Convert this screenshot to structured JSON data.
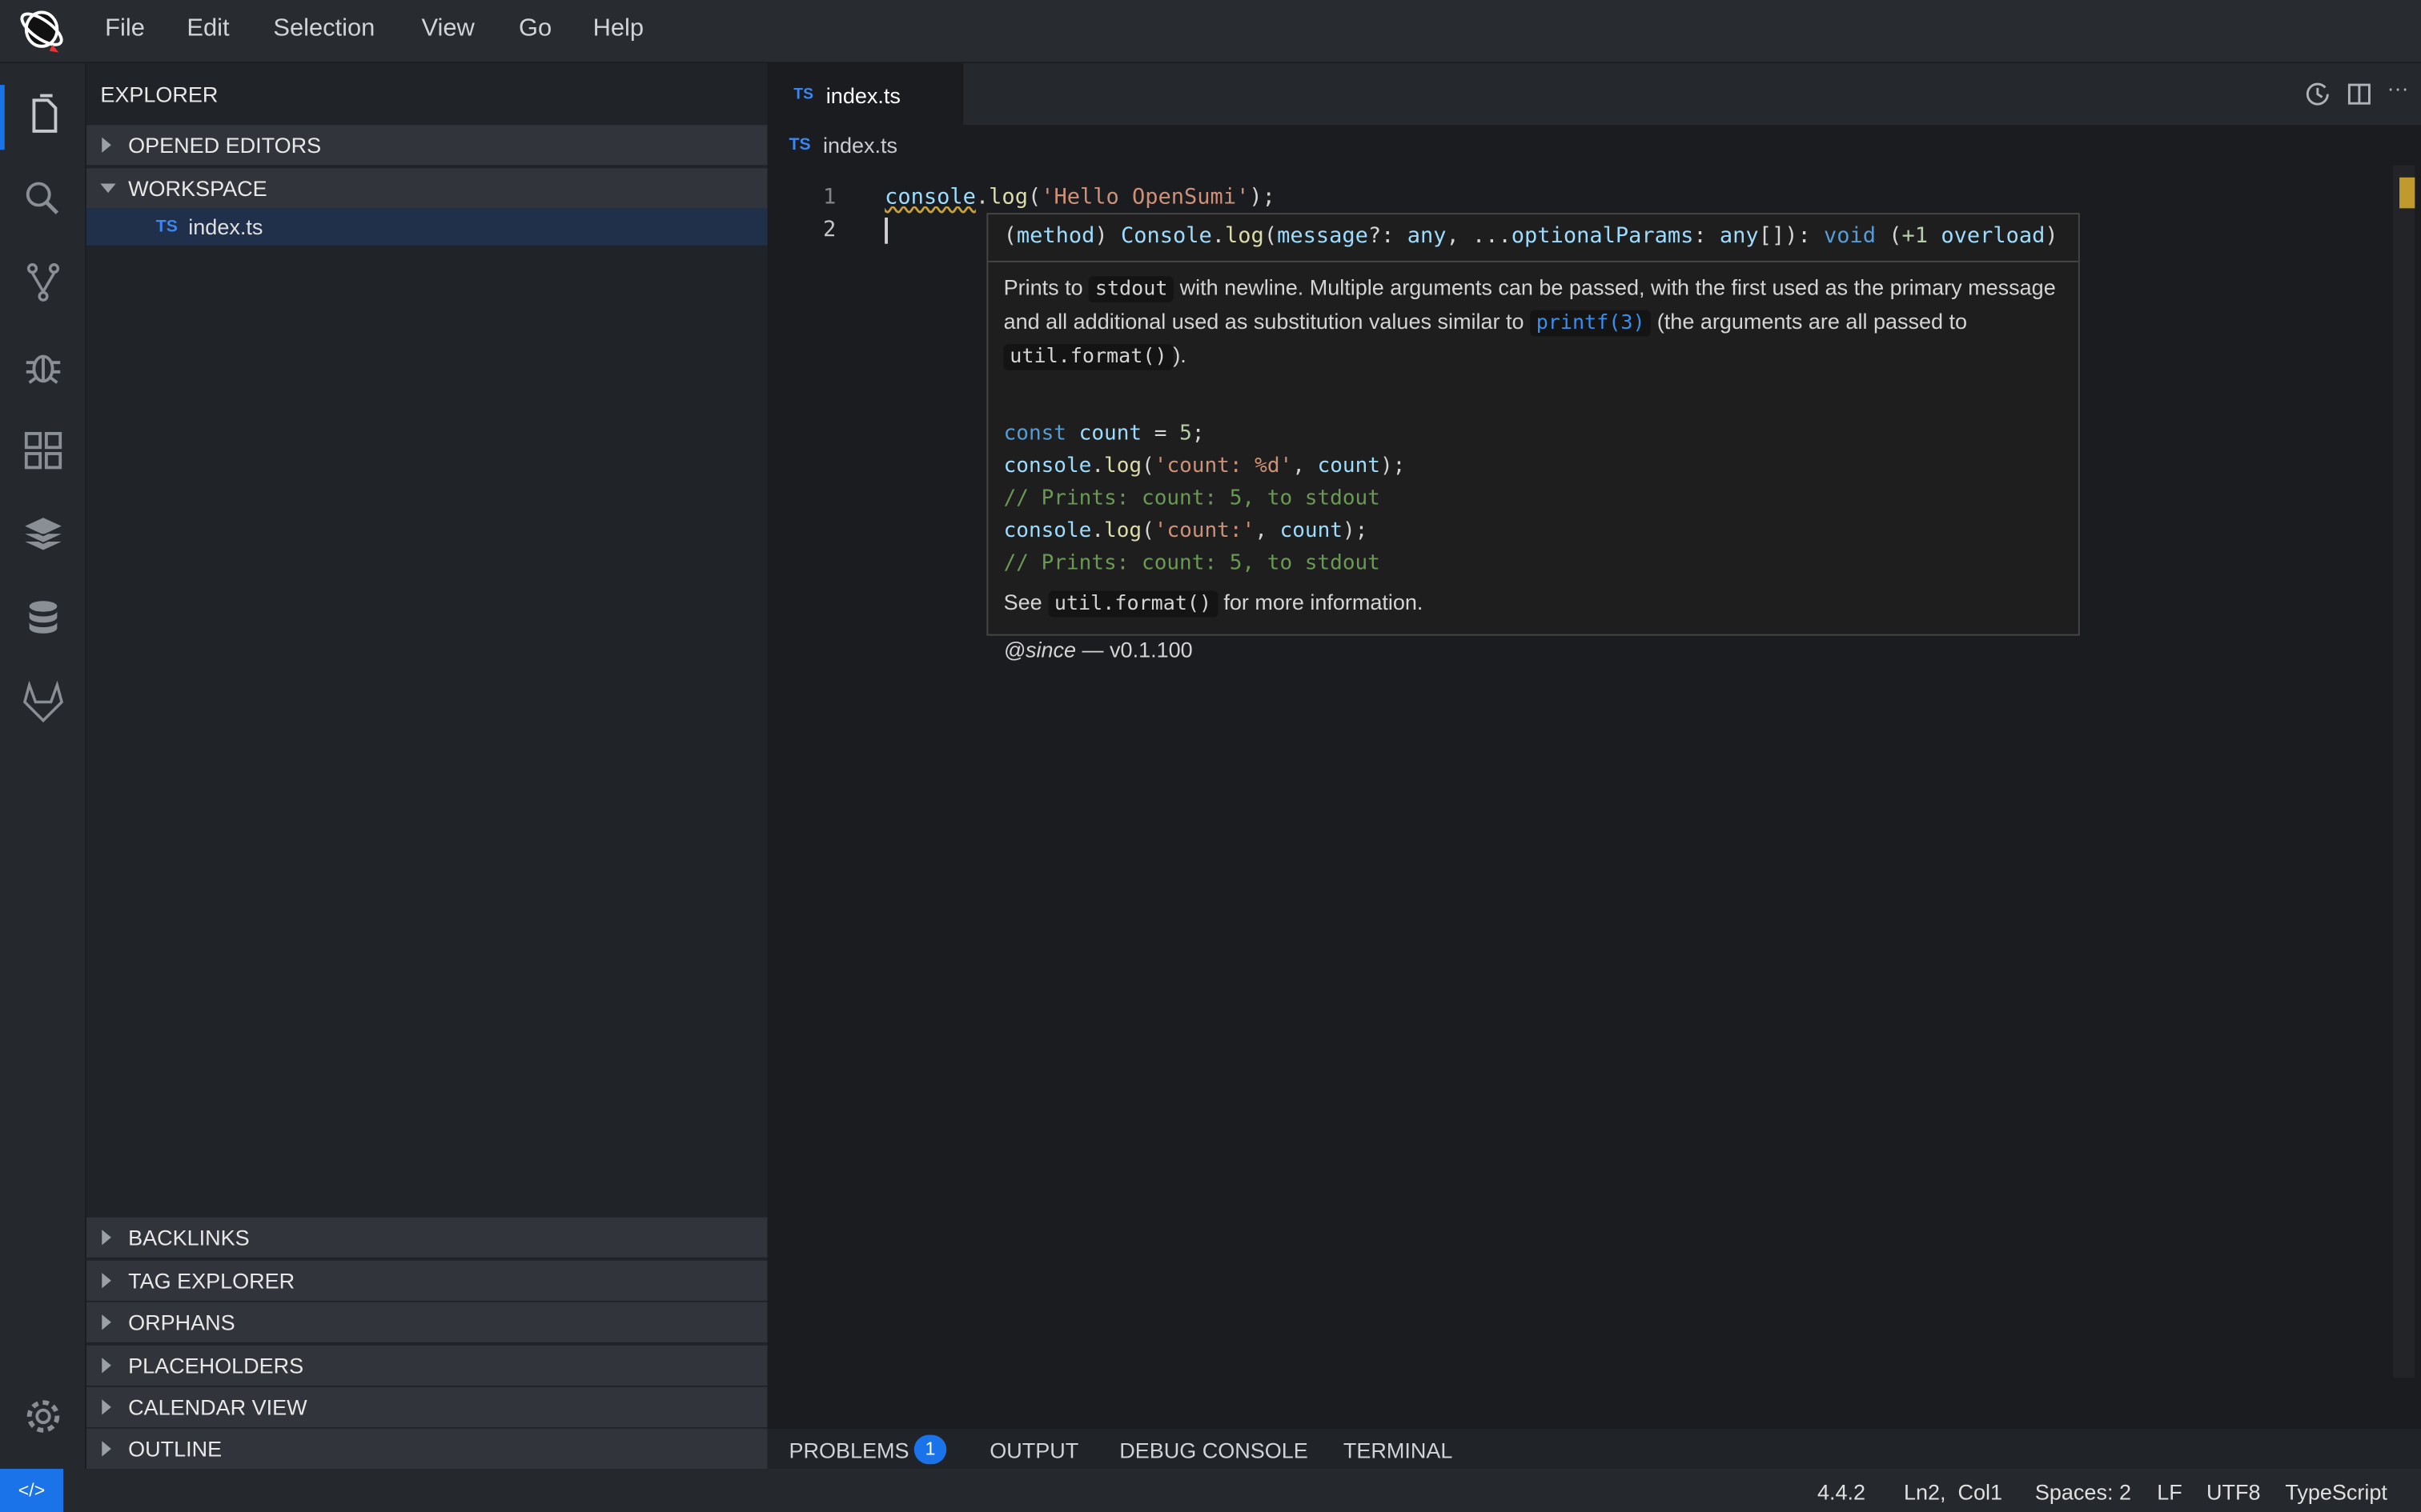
{
  "menubar": {
    "items": [
      "File",
      "Edit",
      "Selection",
      "View",
      "Go",
      "Help"
    ]
  },
  "activity": {
    "icons": [
      "files-icon",
      "search-icon",
      "source-control-icon",
      "debug-icon",
      "extensions-icon",
      "package-icon",
      "database-icon",
      "gitlab-icon",
      "settings-icon"
    ]
  },
  "sidebar": {
    "title": "EXPLORER",
    "opened_editors": "OPENED EDITORS",
    "workspace": "WORKSPACE",
    "file": {
      "badge": "TS",
      "name": "index.ts"
    },
    "bottom_sections": [
      "BACKLINKS",
      "TAG EXPLORER",
      "ORPHANS",
      "PLACEHOLDERS",
      "CALENDAR VIEW",
      "OUTLINE"
    ]
  },
  "editor": {
    "tab": {
      "badge": "TS",
      "name": "index.ts"
    },
    "breadcrumb": {
      "badge": "TS",
      "name": "index.ts"
    },
    "line_numbers": [
      "1",
      "2"
    ],
    "line1": {
      "obj": "console",
      "dot": ".",
      "fn": "log",
      "open": "(",
      "str": "'Hello OpenSumi'",
      "close": ");"
    }
  },
  "hover": {
    "signature": {
      "p1": "(",
      "method": "method",
      "p2": ")",
      "cls": "Console",
      "dot": ".",
      "fn": "log",
      "p3": "(",
      "param1": "message",
      "p4": "?: ",
      "t1": "any",
      "p5": ", ...",
      "param2": "optionalParams",
      "p6": ": ",
      "t2": "any",
      "p7": "[]): ",
      "ret": "void",
      "p8": " (",
      "plus": "+1",
      "ov": " overload",
      "p9": ")"
    },
    "desc1": "Prints to",
    "code1": "stdout",
    "desc2": "with newline. Multiple arguments can be passed, with the first used as the primary message and all additional used as substitution values similar to",
    "link": "printf(3)",
    "desc3": "(the arguments are all passed to",
    "code2": "util.format()",
    "desc4": ").",
    "ex": {
      "l1a": "const",
      "l1b": "count",
      "l1c": " = ",
      "l1d": "5",
      "l1e": ";",
      "l2a": "console",
      "l2b": ".",
      "l2c": "log",
      "l2d": "(",
      "l2e": "'count: %d'",
      "l2f": ", ",
      "l2g": "count",
      "l2h": ");",
      "l3": "// Prints: count: 5, to stdout",
      "l4a": "console",
      "l4b": ".",
      "l4c": "log",
      "l4d": "(",
      "l4e": "'count:'",
      "l4f": ", ",
      "l4g": "count",
      "l4h": ");",
      "l5": "// Prints: count: 5, to stdout"
    },
    "see1": "See",
    "see_code": "util.format()",
    "see2": "for more information.",
    "since_tag": "@since",
    "since_val": " — v0.1.100"
  },
  "panel": {
    "tabs": [
      "PROBLEMS",
      "OUTPUT",
      "DEBUG CONSOLE",
      "TERMINAL"
    ],
    "problems_count": "1"
  },
  "status": {
    "version": "4.4.2",
    "position": "Ln2,  Col1",
    "spaces": "Spaces: 2",
    "eol": "LF",
    "encoding": "UTF8",
    "language": "TypeScript"
  },
  "colors": {
    "accent": "#1a73e8",
    "ts_badge": "#3b86f0",
    "selection": "#21304a"
  }
}
